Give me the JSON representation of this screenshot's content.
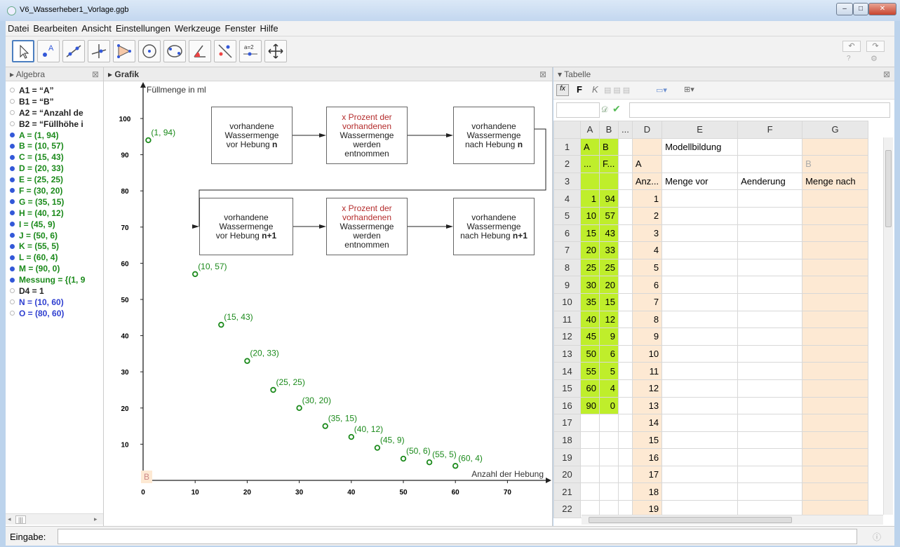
{
  "window": {
    "title": "V6_Wasserheber1_Vorlage.ggb",
    "btn_min": "–",
    "btn_max": "□",
    "btn_close": "✕"
  },
  "menu": [
    "Datei",
    "Bearbeiten",
    "Ansicht",
    "Einstellungen",
    "Werkzeuge",
    "Fenster",
    "Hilfe"
  ],
  "toolbar": {
    "undo": "↶",
    "redo": "↷",
    "tools": [
      "Bewegen",
      "Punkt",
      "Gerade",
      "Senkrechte",
      "Vieleck",
      "Kreis",
      "Kegelschnitt",
      "Winkel",
      "Spiegeln",
      "Schieberegler",
      "Grafik verschieben"
    ],
    "slider_label": "a=2"
  },
  "algebra": {
    "title": "Algebra",
    "items": [
      {
        "t": "A1 = “A”",
        "c": "black",
        "on": false
      },
      {
        "t": "B1 = “B”",
        "c": "black",
        "on": false
      },
      {
        "t": "A2 = “Anzahl de",
        "c": "black",
        "on": false
      },
      {
        "t": "B2 = “Füllhöhe i",
        "c": "black",
        "on": false
      },
      {
        "t": "A = (1, 94)",
        "c": "green",
        "on": true
      },
      {
        "t": "B = (10, 57)",
        "c": "green",
        "on": true
      },
      {
        "t": "C = (15, 43)",
        "c": "green",
        "on": true
      },
      {
        "t": "D = (20, 33)",
        "c": "green",
        "on": true
      },
      {
        "t": "E = (25, 25)",
        "c": "green",
        "on": true
      },
      {
        "t": "F = (30, 20)",
        "c": "green",
        "on": true
      },
      {
        "t": "G = (35, 15)",
        "c": "green",
        "on": true
      },
      {
        "t": "H = (40, 12)",
        "c": "green",
        "on": true
      },
      {
        "t": "I = (45, 9)",
        "c": "green",
        "on": true
      },
      {
        "t": "J = (50, 6)",
        "c": "green",
        "on": true
      },
      {
        "t": "K = (55, 5)",
        "c": "green",
        "on": true
      },
      {
        "t": "L = (60, 4)",
        "c": "green",
        "on": true
      },
      {
        "t": "M = (90, 0)",
        "c": "green",
        "on": true
      },
      {
        "t": "Messung = {(1, 9",
        "c": "green",
        "on": true
      },
      {
        "t": "D4 = 1",
        "c": "black",
        "on": false
      },
      {
        "t": "N = (10, 60)",
        "c": "blue",
        "on": false
      },
      {
        "t": "O = (80, 60)",
        "c": "blue",
        "on": false
      }
    ],
    "scroll_left": "◂",
    "scroll_right": "▸",
    "scroll_thumb": "|||"
  },
  "grafik": {
    "title": "Grafik",
    "marker": "B",
    "boxes": [
      {
        "lines": [
          "vorhandene",
          "Wassermenge",
          "vor Hebung n"
        ],
        "bold": "n"
      },
      {
        "red": [
          "x Prozent der",
          "vorhandenen"
        ],
        "lines": [
          "Wassermenge",
          "werden",
          "entnommen"
        ]
      },
      {
        "lines": [
          "vorhandene",
          "Wassermenge",
          "nach Hebung n"
        ],
        "bold": "n"
      },
      {
        "lines": [
          "vorhandene",
          "Wassermenge",
          "vor Hebung n+1"
        ],
        "bold": "n+1"
      },
      {
        "red": [
          "x Prozent der",
          "vorhandenen"
        ],
        "lines": [
          "Wassermenge",
          "werden",
          "entnommen"
        ]
      },
      {
        "lines": [
          "vorhandene",
          "Wassermenge",
          "nach Hebung n+1"
        ],
        "bold": "n+1"
      }
    ]
  },
  "chart_data": {
    "type": "scatter",
    "ylabel": "Füllmenge in ml",
    "xlabel": "Anzahl der Hebung",
    "xlim": [
      0,
      75
    ],
    "ylim": [
      0,
      105
    ],
    "xticks": [
      0,
      10,
      20,
      30,
      40,
      50,
      60,
      70
    ],
    "yticks": [
      10,
      20,
      30,
      40,
      50,
      60,
      70,
      80,
      90,
      100
    ],
    "points": [
      [
        1,
        94
      ],
      [
        10,
        57
      ],
      [
        15,
        43
      ],
      [
        20,
        33
      ],
      [
        25,
        25
      ],
      [
        30,
        20
      ],
      [
        35,
        15
      ],
      [
        40,
        12
      ],
      [
        45,
        9
      ],
      [
        50,
        6
      ],
      [
        55,
        5
      ],
      [
        60,
        4
      ]
    ],
    "labels": [
      "(1, 94)",
      "(10, 57)",
      "(15, 43)",
      "(20, 33)",
      "(25, 25)",
      "(30, 20)",
      "(35, 15)",
      "(40, 12)",
      "(45, 9)",
      "(50, 6)",
      "(55, 5)",
      "(60, 4)"
    ],
    "color": "#1b8a1b"
  },
  "tabelle": {
    "title": "Tabelle",
    "fmt": [
      "fx",
      "F",
      "K"
    ],
    "cols": [
      "",
      "A",
      "B",
      "...",
      "D",
      "E",
      "F",
      "G"
    ],
    "rows": [
      [
        "1",
        "A",
        "B",
        "",
        "",
        "Modellbildung",
        "",
        ""
      ],
      [
        "2",
        "...",
        "F...",
        "",
        "A",
        "",
        "",
        "B"
      ],
      [
        "3",
        "",
        "",
        "",
        "Anz...",
        "Menge vor",
        "Aenderung",
        "Menge nach"
      ],
      [
        "4",
        "1",
        "94",
        "",
        "1",
        "",
        "",
        ""
      ],
      [
        "5",
        "10",
        "57",
        "",
        "2",
        "",
        "",
        ""
      ],
      [
        "6",
        "15",
        "43",
        "",
        "3",
        "",
        "",
        ""
      ],
      [
        "7",
        "20",
        "33",
        "",
        "4",
        "",
        "",
        ""
      ],
      [
        "8",
        "25",
        "25",
        "",
        "5",
        "",
        "",
        ""
      ],
      [
        "9",
        "30",
        "20",
        "",
        "6",
        "",
        "",
        ""
      ],
      [
        "10",
        "35",
        "15",
        "",
        "7",
        "",
        "",
        ""
      ],
      [
        "11",
        "40",
        "12",
        "",
        "8",
        "",
        "",
        ""
      ],
      [
        "12",
        "45",
        "9",
        "",
        "9",
        "",
        "",
        ""
      ],
      [
        "13",
        "50",
        "6",
        "",
        "10",
        "",
        "",
        ""
      ],
      [
        "14",
        "55",
        "5",
        "",
        "11",
        "",
        "",
        ""
      ],
      [
        "15",
        "60",
        "4",
        "",
        "12",
        "",
        "",
        ""
      ],
      [
        "16",
        "90",
        "0",
        "",
        "13",
        "",
        "",
        ""
      ],
      [
        "17",
        "",
        "",
        "",
        "14",
        "",
        "",
        ""
      ],
      [
        "18",
        "",
        "",
        "",
        "15",
        "",
        "",
        ""
      ],
      [
        "19",
        "",
        "",
        "",
        "16",
        "",
        "",
        ""
      ],
      [
        "20",
        "",
        "",
        "",
        "17",
        "",
        "",
        ""
      ],
      [
        "21",
        "",
        "",
        "",
        "18",
        "",
        "",
        ""
      ],
      [
        "22",
        "",
        "",
        "",
        "19",
        "",
        "",
        ""
      ]
    ]
  },
  "input": {
    "label": "Eingabe:",
    "value": ""
  }
}
